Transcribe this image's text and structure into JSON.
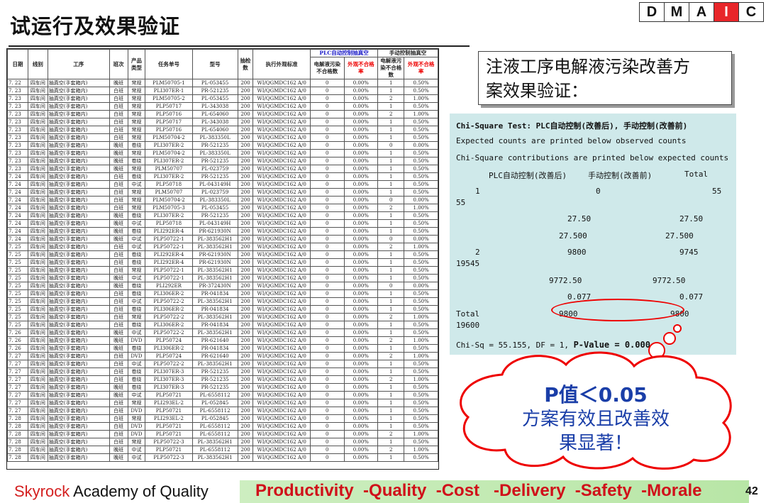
{
  "title": "试运行及效果验证",
  "dmaic": [
    "D",
    "M",
    "A",
    "I",
    "C"
  ],
  "dmaic_active": "I",
  "table": {
    "group_plc": "PLC自动控制抽真空",
    "group_manual": "手动控制抽真空",
    "headers": [
      "日期",
      "线别",
      "工序",
      "班次",
      "产品类型",
      "任务单号",
      "型号",
      "抽检数",
      "执行外观标准",
      "电解液污染不合格数",
      "外观不合格率",
      "电解液污染不合格数",
      "外观不合格率"
    ],
    "rows": [
      [
        "7. 22",
        "四车间",
        "抽真空(手套箱内)",
        "晚班",
        "常规",
        "PLM50705-1",
        "PL-053455",
        "200",
        "WI/QGMDC162 A/0",
        "0",
        "0.00%",
        "1",
        "0.50%"
      ],
      [
        "7. 23",
        "四车间",
        "抽真空(手套箱内)",
        "白班",
        "常规",
        "PLI307ER-1",
        "PR-521235",
        "200",
        "WI/QGMDC162 A/0",
        "0",
        "0.00%",
        "1",
        "0.50%"
      ],
      [
        "7. 23",
        "四车间",
        "抽真空(手套箱内)",
        "白班",
        "常规",
        "PLM50705-2",
        "PL-053455",
        "200",
        "WI/QGMDC162 A/0",
        "0",
        "0.00%",
        "2",
        "1.00%"
      ],
      [
        "7. 23",
        "四车间",
        "抽真空(手套箱内)",
        "白班",
        "常规",
        "PLP50717",
        "PL-343038",
        "200",
        "WI/QGMDC162 A/0",
        "0",
        "0.00%",
        "1",
        "0.50%"
      ],
      [
        "7. 23",
        "四车间",
        "抽真空(手套箱内)",
        "白班",
        "常规",
        "PLP50716",
        "PL-654060",
        "200",
        "WI/QGMDC162 A/0",
        "0",
        "0.00%",
        "2",
        "1.00%"
      ],
      [
        "7. 23",
        "四车间",
        "抽真空(手套箱内)",
        "白班",
        "常规",
        "PLP50717",
        "PL-343038",
        "200",
        "WI/QGMDC162 A/0",
        "0",
        "0.00%",
        "1",
        "0.50%"
      ],
      [
        "7. 23",
        "四车间",
        "抽真空(手套箱内)",
        "白班",
        "常规",
        "PLP50716",
        "PL-654060",
        "200",
        "WI/QGMDC162 A/0",
        "0",
        "0.00%",
        "1",
        "0.50%"
      ],
      [
        "7. 23",
        "四车间",
        "抽真空(手套箱内)",
        "白班",
        "常规",
        "PLM50704-2",
        "PL-383350L",
        "200",
        "WI/QGMDC162 A/0",
        "0",
        "0.00%",
        "1",
        "0.50%"
      ],
      [
        "7. 23",
        "四车间",
        "抽真空(手套箱内)",
        "晚班",
        "卷绕",
        "PLI307ER-2",
        "PR-521235",
        "200",
        "WI/QGMDC162 A/0",
        "0",
        "0.00%",
        "0",
        "0.00%"
      ],
      [
        "7. 23",
        "四车间",
        "抽真空(手套箱内)",
        "晚班",
        "常规",
        "PLM50704-2",
        "PL-383350L",
        "200",
        "WI/QGMDC162 A/0",
        "0",
        "0.00%",
        "1",
        "0.50%"
      ],
      [
        "7. 23",
        "四车间",
        "抽真空(手套箱内)",
        "晚班",
        "卷绕",
        "PLI307ER-2",
        "PR-521235",
        "200",
        "WI/QGMDC162 A/0",
        "0",
        "0.00%",
        "1",
        "0.50%"
      ],
      [
        "7. 23",
        "四车间",
        "抽真空(手套箱内)",
        "晚班",
        "常规",
        "PLM50707",
        "PL-023759",
        "200",
        "WI/QGMDC162 A/0",
        "0",
        "0.00%",
        "1",
        "0.50%"
      ],
      [
        "7. 24",
        "四车间",
        "抽真空(手套箱内)",
        "白班",
        "卷绕",
        "PLI307ER-2",
        "PR-521235",
        "200",
        "WI/QGMDC162 A/0",
        "0",
        "0.00%",
        "1",
        "0.50%"
      ],
      [
        "7. 24",
        "四车间",
        "抽真空(手套箱内)",
        "白班",
        "中试",
        "PLP50718",
        "PL-043149H",
        "200",
        "WI/QGMDC162 A/0",
        "0",
        "0.00%",
        "1",
        "0.50%"
      ],
      [
        "7. 24",
        "四车间",
        "抽真空(手套箱内)",
        "白班",
        "常规",
        "PLM50707",
        "PL-023759",
        "200",
        "WI/QGMDC162 A/0",
        "0",
        "0.00%",
        "1",
        "0.50%"
      ],
      [
        "7. 24",
        "四车间",
        "抽真空(手套箱内)",
        "白班",
        "常规",
        "PLM50704-2",
        "PL-383350L",
        "200",
        "WI/QGMDC162 A/0",
        "0",
        "0.00%",
        "0",
        "0.00%"
      ],
      [
        "7. 24",
        "四车间",
        "抽真空(手套箱内)",
        "白班",
        "常规",
        "PLM50705-3",
        "PL-053455",
        "200",
        "WI/QGMDC162 A/0",
        "0",
        "0.00%",
        "2",
        "1.00%"
      ],
      [
        "7. 24",
        "四车间",
        "抽真空(手套箱内)",
        "晚班",
        "卷绕",
        "PLI307ER-2",
        "PR-521235",
        "200",
        "WI/QGMDC162 A/0",
        "0",
        "0.00%",
        "1",
        "0.50%"
      ],
      [
        "7. 24",
        "四车间",
        "抽真空(手套箱内)",
        "晚班",
        "中试",
        "PLP50718",
        "PL-043149H",
        "200",
        "WI/QGMDC162 A/0",
        "0",
        "0.00%",
        "1",
        "0.50%"
      ],
      [
        "7. 24",
        "四车间",
        "抽真空(手套箱内)",
        "晚班",
        "卷绕",
        "PLI292ER-4",
        "PR-621930N",
        "200",
        "WI/QGMDC162 A/0",
        "0",
        "0.00%",
        "1",
        "0.50%"
      ],
      [
        "7. 24",
        "四车间",
        "抽真空(手套箱内)",
        "晚班",
        "中试",
        "PLP50722-1",
        "PL-383562H1",
        "200",
        "WI/QGMDC162 A/0",
        "0",
        "0.00%",
        "0",
        "0.00%"
      ],
      [
        "7. 25",
        "四车间",
        "抽真空(手套箱内)",
        "白班",
        "中试",
        "PLP50722-1",
        "PL-383562H1",
        "200",
        "WI/QGMDC162 A/0",
        "0",
        "0.00%",
        "2",
        "1.00%"
      ],
      [
        "7. 25",
        "四车间",
        "抽真空(手套箱内)",
        "白班",
        "卷绕",
        "PLI292ER-4",
        "PR-621930N",
        "200",
        "WI/QGMDC162 A/0",
        "0",
        "0.00%",
        "1",
        "0.50%"
      ],
      [
        "7. 25",
        "四车间",
        "抽真空(手套箱内)",
        "白班",
        "卷绕",
        "PLI292ER-4",
        "PR-621930N",
        "200",
        "WI/QGMDC162 A/0",
        "0",
        "0.00%",
        "1",
        "0.50%"
      ],
      [
        "7. 25",
        "四车间",
        "抽真空(手套箱内)",
        "白班",
        "常规",
        "PLP50722-1",
        "PL-383562H1",
        "200",
        "WI/QGMDC162 A/0",
        "0",
        "0.00%",
        "1",
        "0.50%"
      ],
      [
        "7. 25",
        "四车间",
        "抽真空(手套箱内)",
        "晚班",
        "中试",
        "PLP50722-1",
        "PL-383562H1",
        "200",
        "WI/QGMDC162 A/0",
        "0",
        "0.00%",
        "1",
        "0.50%"
      ],
      [
        "7. 25",
        "四车间",
        "抽真空(手套箱内)",
        "晚班",
        "卷绕",
        "PLI292ER",
        "PR-372430N",
        "200",
        "WI/QGMDC162 A/0",
        "0",
        "0.00%",
        "0",
        "0.00%"
      ],
      [
        "7. 25",
        "四车间",
        "抽真空(手套箱内)",
        "白班",
        "卷绕",
        "PLI306ER-2",
        "PR-041834",
        "200",
        "WI/QGMDC162 A/0",
        "0",
        "0.00%",
        "1",
        "0.50%"
      ],
      [
        "7. 25",
        "四车间",
        "抽真空(手套箱内)",
        "白班",
        "中试",
        "PLP50722-2",
        "PL-383562H1",
        "200",
        "WI/QGMDC162 A/0",
        "0",
        "0.00%",
        "1",
        "0.50%"
      ],
      [
        "7. 25",
        "四车间",
        "抽真空(手套箱内)",
        "白班",
        "卷绕",
        "PLI306ER-2",
        "PR-041834",
        "200",
        "WI/QGMDC162 A/0",
        "0",
        "0.00%",
        "1",
        "0.50%"
      ],
      [
        "7. 25",
        "四车间",
        "抽真空(手套箱内)",
        "白班",
        "常规",
        "PLP50722-2",
        "PL-383562H1",
        "200",
        "WI/QGMDC162 A/0",
        "0",
        "0.00%",
        "2",
        "1.00%"
      ],
      [
        "7. 25",
        "四车间",
        "抽真空(手套箱内)",
        "白班",
        "卷绕",
        "PLI306ER-2",
        "PR-041834",
        "200",
        "WI/QGMDC162 A/0",
        "0",
        "0.00%",
        "1",
        "0.50%"
      ],
      [
        "7. 26",
        "四车间",
        "抽真空(手套箱内)",
        "晚班",
        "中试",
        "PLP50722-2",
        "PL-383562H1",
        "200",
        "WI/QGMDC162 A/0",
        "0",
        "0.00%",
        "1",
        "0.50%"
      ],
      [
        "7. 26",
        "四车间",
        "抽真空(手套箱内)",
        "晚班",
        "DVD",
        "PLP50724",
        "PR-621640",
        "200",
        "WI/QGMDC162 A/0",
        "0",
        "0.00%",
        "2",
        "1.00%"
      ],
      [
        "7. 26",
        "四车间",
        "抽真空(手套箱内)",
        "晚班",
        "卷绕",
        "PLI306ER-2",
        "PR-041834",
        "200",
        "WI/QGMDC162 A/0",
        "0",
        "0.00%",
        "1",
        "0.50%"
      ],
      [
        "7. 27",
        "四车间",
        "抽真空(手套箱内)",
        "白班",
        "DVD",
        "PLP50724",
        "PR-621640",
        "200",
        "WI/QGMDC162 A/0",
        "0",
        "0.00%",
        "2",
        "1.00%"
      ],
      [
        "7. 27",
        "四车间",
        "抽真空(手套箱内)",
        "白班",
        "中试",
        "PLP50722-2",
        "PL-383562H1",
        "200",
        "WI/QGMDC162 A/0",
        "0",
        "0.00%",
        "1",
        "0.50%"
      ],
      [
        "7. 27",
        "四车间",
        "抽真空(手套箱内)",
        "白班",
        "卷绕",
        "PLI307ER-3",
        "PR-521235",
        "200",
        "WI/QGMDC162 A/0",
        "0",
        "0.00%",
        "1",
        "0.50%"
      ],
      [
        "7. 27",
        "四车间",
        "抽真空(手套箱内)",
        "白班",
        "卷绕",
        "PLI307ER-3",
        "PR-521235",
        "200",
        "WI/QGMDC162 A/0",
        "0",
        "0.00%",
        "2",
        "1.00%"
      ],
      [
        "7. 27",
        "四车间",
        "抽真空(手套箱内)",
        "晚班",
        "卷绕",
        "PLI307ER-3",
        "PR-521235",
        "200",
        "WI/QGMDC162 A/0",
        "0",
        "0.00%",
        "1",
        "0.50%"
      ],
      [
        "7. 27",
        "四车间",
        "抽真空(手套箱内)",
        "晚班",
        "中试",
        "PLP50721",
        "PL-6558112",
        "200",
        "WI/QGMDC162 A/0",
        "0",
        "0.00%",
        "1",
        "0.50%"
      ],
      [
        "7. 27",
        "四车间",
        "抽真空(手套箱内)",
        "白班",
        "常规",
        "PLI293EL-2",
        "PL-052845",
        "200",
        "WI/QGMDC162 A/0",
        "0",
        "0.00%",
        "1",
        "0.50%"
      ],
      [
        "7. 27",
        "四车间",
        "抽真空(手套箱内)",
        "白班",
        "DVD",
        "PLP50721",
        "PL-6558112",
        "200",
        "WI/QGMDC162 A/0",
        "0",
        "0.00%",
        "1",
        "0.50%"
      ],
      [
        "7. 28",
        "四车间",
        "抽真空(手套箱内)",
        "白班",
        "常规",
        "PLI293EL-2",
        "PL-052845",
        "200",
        "WI/QGMDC162 A/0",
        "0",
        "0.00%",
        "1",
        "0.50%"
      ],
      [
        "7. 28",
        "四车间",
        "抽真空(手套箱内)",
        "白班",
        "DVD",
        "PLP50721",
        "PL-6558112",
        "200",
        "WI/QGMDC162 A/0",
        "0",
        "0.00%",
        "1",
        "0.50%"
      ],
      [
        "7. 28",
        "四车间",
        "抽真空(手套箱内)",
        "白班",
        "DVD",
        "PLP50721",
        "PL-6558112",
        "200",
        "WI/QGMDC162 A/0",
        "0",
        "0.00%",
        "2",
        "1.00%"
      ],
      [
        "7. 28",
        "四车间",
        "抽真空(手套箱内)",
        "白班",
        "常规",
        "PLP50722-3",
        "PL-383562H1",
        "200",
        "WI/QGMDC162 A/0",
        "0",
        "0.00%",
        "1",
        "0.50%"
      ],
      [
        "7. 28",
        "四车间",
        "抽真空(手套箱内)",
        "晚班",
        "中试",
        "PLP50721",
        "PL-6558112",
        "200",
        "WI/QGMDC162 A/0",
        "0",
        "0.00%",
        "2",
        "1.00%"
      ],
      [
        "7. 28",
        "四车间",
        "抽真空(手套箱内)",
        "晚班",
        "中试",
        "PLP50722-3",
        "PL-383562H1",
        "200",
        "WI/QGMDC162 A/0",
        "0",
        "0.00%",
        "1",
        "0.50%"
      ]
    ]
  },
  "callout": {
    "line1": "注液工序电解液污染改善方",
    "line2": "案效果验证："
  },
  "minitab": {
    "title": "Chi-Square Test: PLC自动控制(改善后), 手动控制(改善前)",
    "note1": "Expected counts are printed below observed counts",
    "note2": "Chi-Square contributions are printed below expected counts",
    "col1": "PLC自动控制(改善后)",
    "col2": "手动控制(改善前)",
    "col3": "Total",
    "r1_idx": "1",
    "r1_a": "0",
    "r1_b": "55",
    "r1_total": "55",
    "r1_exp_a": "27.50",
    "r1_exp_b": "27.50",
    "r1_con_a": "27.500",
    "r1_con_b": "27.500",
    "r2_idx": "2",
    "r2_a": "9800",
    "r2_b": "9745",
    "r2_total": "19545",
    "r2_exp_a": "9772.50",
    "r2_exp_b": "9772.50",
    "r2_con_a": "0.077",
    "r2_con_b": "0.077",
    "tot_label": "Total",
    "tot_a": "9800",
    "tot_b": "9800",
    "tot_total": "19600",
    "stat_prefix": "Chi-Sq = 55.155, DF = 1, ",
    "pvalue": "P-Value = 0.000"
  },
  "cloud": {
    "line1": "P值＜0.05",
    "line2": "方案有效且改善效",
    "line3": "果显著！"
  },
  "footer": {
    "brand": "Skyrock",
    "academy": " Academy of Quality",
    "slogan": "Productivity  -Quality  -Cost   -Delivery  -Safety  -Morale",
    "page": "42"
  }
}
